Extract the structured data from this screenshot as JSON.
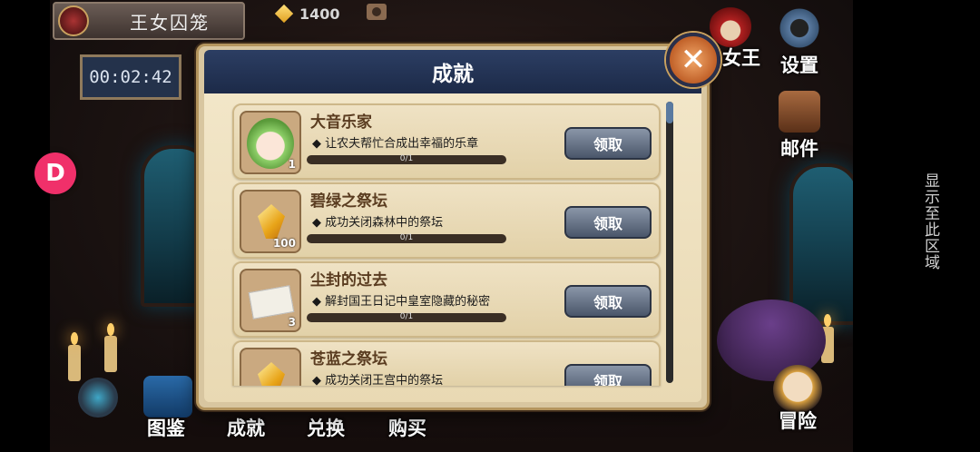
{
  "hud": {
    "room_title": "王女囚笼",
    "timer": "00:02:42",
    "gems": "1400",
    "colors": {
      "panel_header": "#2c3e63",
      "accent": "#f0306a"
    }
  },
  "side_menu": {
    "queen_label": "女王",
    "settings_label": "设置",
    "mail_label": "邮件",
    "adventure_label": "冒险"
  },
  "bottom_nav": {
    "gallery_label": "图鉴",
    "achievements_label": "成就",
    "exchange_label": "兑换",
    "shop_label": "购买"
  },
  "overlay": {
    "floating_button": "D",
    "vertical_label": "显示至此区域"
  },
  "dialog": {
    "title": "成就",
    "close_icon": "close-icon",
    "items": [
      {
        "title": "大音乐家",
        "desc": "◆ 让农夫帮忙合成出幸福的乐章",
        "progress": "0/1",
        "count": "1",
        "claim": "领取",
        "icon": "character-portrait-icon"
      },
      {
        "title": "碧绿之祭坛",
        "desc": "◆ 成功关闭森林中的祭坛",
        "progress": "0/1",
        "count": "100",
        "claim": "领取",
        "icon": "gem-icon"
      },
      {
        "title": "尘封的过去",
        "desc": "◆ 解封国王日记中皇室隐藏的秘密",
        "progress": "0/1",
        "count": "3",
        "claim": "领取",
        "icon": "ticket-icon"
      },
      {
        "title": "苍蓝之祭坛",
        "desc": "◆ 成功关闭王宫中的祭坛",
        "progress": "",
        "count": "",
        "claim": "领取",
        "icon": "gem-icon"
      }
    ]
  }
}
